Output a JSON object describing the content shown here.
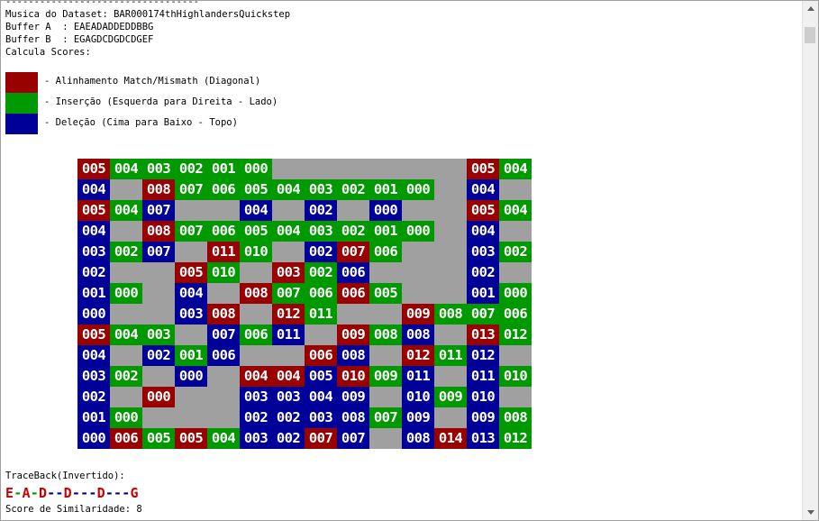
{
  "header_lines": [
    "----------------------------------",
    "Musica do Dataset: BAR000174thHighlandersQuickstep",
    "Buffer A  : EAEADADDEDDBBG",
    "Buffer B  : EGAGDCDGDCDGEF",
    "Calcula Scores:"
  ],
  "legend": [
    {
      "color": "#990000",
      "label": "- Alinhamento Match/Mismath (Diagonal)"
    },
    {
      "color": "#009900",
      "label": "- Inserção (Esquerda para Direita - Lado)"
    },
    {
      "color": "#000099",
      "label": "- Deleção (Cima para Baixo - Topo)"
    }
  ],
  "colors": {
    "R": "#990000",
    "G": "#009900",
    "B": "#000099",
    "empty": "#a0a0a0"
  },
  "matrix": [
    [
      [
        "R",
        "005"
      ],
      [
        "G",
        "004"
      ],
      [
        "G",
        "003"
      ],
      [
        "G",
        "002"
      ],
      [
        "G",
        "001"
      ],
      [
        "G",
        "000"
      ],
      null,
      null,
      null,
      null,
      null,
      null,
      [
        "R",
        "005"
      ],
      [
        "G",
        "004"
      ]
    ],
    [
      [
        "B",
        "004"
      ],
      null,
      [
        "R",
        "008"
      ],
      [
        "G",
        "007"
      ],
      [
        "G",
        "006"
      ],
      [
        "G",
        "005"
      ],
      [
        "G",
        "004"
      ],
      [
        "G",
        "003"
      ],
      [
        "G",
        "002"
      ],
      [
        "G",
        "001"
      ],
      [
        "G",
        "000"
      ],
      null,
      [
        "B",
        "004"
      ],
      null
    ],
    [
      [
        "R",
        "005"
      ],
      [
        "G",
        "004"
      ],
      [
        "B",
        "007"
      ],
      null,
      null,
      [
        "B",
        "004"
      ],
      null,
      [
        "B",
        "002"
      ],
      null,
      [
        "B",
        "000"
      ],
      null,
      null,
      [
        "R",
        "005"
      ],
      [
        "G",
        "004"
      ]
    ],
    [
      [
        "B",
        "004"
      ],
      null,
      [
        "R",
        "008"
      ],
      [
        "G",
        "007"
      ],
      [
        "G",
        "006"
      ],
      [
        "G",
        "005"
      ],
      [
        "G",
        "004"
      ],
      [
        "G",
        "003"
      ],
      [
        "G",
        "002"
      ],
      [
        "G",
        "001"
      ],
      [
        "G",
        "000"
      ],
      null,
      [
        "B",
        "004"
      ],
      null
    ],
    [
      [
        "B",
        "003"
      ],
      [
        "G",
        "002"
      ],
      [
        "B",
        "007"
      ],
      null,
      [
        "R",
        "011"
      ],
      [
        "G",
        "010"
      ],
      null,
      [
        "B",
        "002"
      ],
      [
        "R",
        "007"
      ],
      [
        "G",
        "006"
      ],
      null,
      null,
      [
        "B",
        "003"
      ],
      [
        "G",
        "002"
      ]
    ],
    [
      [
        "B",
        "002"
      ],
      null,
      null,
      [
        "R",
        "005"
      ],
      [
        "G",
        "010"
      ],
      null,
      [
        "R",
        "003"
      ],
      [
        "G",
        "002"
      ],
      [
        "B",
        "006"
      ],
      null,
      null,
      null,
      [
        "B",
        "002"
      ],
      null
    ],
    [
      [
        "B",
        "001"
      ],
      [
        "G",
        "000"
      ],
      null,
      [
        "B",
        "004"
      ],
      null,
      [
        "R",
        "008"
      ],
      [
        "G",
        "007"
      ],
      [
        "G",
        "006"
      ],
      [
        "R",
        "006"
      ],
      [
        "G",
        "005"
      ],
      null,
      null,
      [
        "B",
        "001"
      ],
      [
        "G",
        "000"
      ]
    ],
    [
      [
        "B",
        "000"
      ],
      null,
      null,
      [
        "B",
        "003"
      ],
      [
        "R",
        "008"
      ],
      null,
      [
        "R",
        "012"
      ],
      [
        "G",
        "011"
      ],
      null,
      null,
      [
        "R",
        "009"
      ],
      [
        "G",
        "008"
      ],
      [
        "G",
        "007"
      ],
      [
        "G",
        "006"
      ]
    ],
    [
      [
        "R",
        "005"
      ],
      [
        "G",
        "004"
      ],
      [
        "G",
        "003"
      ],
      null,
      [
        "B",
        "007"
      ],
      [
        "G",
        "006"
      ],
      [
        "B",
        "011"
      ],
      null,
      [
        "R",
        "009"
      ],
      [
        "G",
        "008"
      ],
      [
        "B",
        "008"
      ],
      null,
      [
        "R",
        "013"
      ],
      [
        "G",
        "012"
      ]
    ],
    [
      [
        "B",
        "004"
      ],
      null,
      [
        "B",
        "002"
      ],
      [
        "G",
        "001"
      ],
      [
        "B",
        "006"
      ],
      null,
      null,
      [
        "R",
        "006"
      ],
      [
        "B",
        "008"
      ],
      null,
      [
        "R",
        "012"
      ],
      [
        "G",
        "011"
      ],
      [
        "B",
        "012"
      ],
      null
    ],
    [
      [
        "B",
        "003"
      ],
      [
        "G",
        "002"
      ],
      null,
      [
        "B",
        "000"
      ],
      null,
      [
        "R",
        "004"
      ],
      [
        "R",
        "004"
      ],
      [
        "B",
        "005"
      ],
      [
        "R",
        "010"
      ],
      [
        "G",
        "009"
      ],
      [
        "B",
        "011"
      ],
      null,
      [
        "B",
        "011"
      ],
      [
        "G",
        "010"
      ]
    ],
    [
      [
        "B",
        "002"
      ],
      null,
      [
        "R",
        "000"
      ],
      null,
      null,
      [
        "B",
        "003"
      ],
      [
        "B",
        "003"
      ],
      [
        "B",
        "004"
      ],
      [
        "B",
        "009"
      ],
      null,
      [
        "B",
        "010"
      ],
      [
        "G",
        "009"
      ],
      [
        "B",
        "010"
      ],
      null
    ],
    [
      [
        "B",
        "001"
      ],
      [
        "G",
        "000"
      ],
      null,
      null,
      null,
      [
        "B",
        "002"
      ],
      [
        "B",
        "002"
      ],
      [
        "B",
        "003"
      ],
      [
        "B",
        "008"
      ],
      [
        "G",
        "007"
      ],
      [
        "B",
        "009"
      ],
      null,
      [
        "B",
        "009"
      ],
      [
        "G",
        "008"
      ]
    ],
    [
      [
        "B",
        "000"
      ],
      [
        "R",
        "006"
      ],
      [
        "G",
        "005"
      ],
      [
        "R",
        "005"
      ],
      [
        "G",
        "004"
      ],
      [
        "B",
        "003"
      ],
      [
        "B",
        "002"
      ],
      [
        "R",
        "007"
      ],
      [
        "B",
        "007"
      ],
      null,
      [
        "B",
        "008"
      ],
      [
        "R",
        "014"
      ],
      [
        "B",
        "013"
      ],
      [
        "G",
        "012"
      ]
    ]
  ],
  "traceback_label": "TraceBack(Invertido):",
  "traceback": [
    {
      "t": "E",
      "c": "#cc0000"
    },
    {
      "t": "-",
      "c": "#009900"
    },
    {
      "t": "A",
      "c": "#cc0000"
    },
    {
      "t": "-",
      "c": "#009900"
    },
    {
      "t": "D",
      "c": "#cc0000"
    },
    {
      "t": "--",
      "c": "#000099"
    },
    {
      "t": "D",
      "c": "#cc0000"
    },
    {
      "t": "---",
      "c": "#000099"
    },
    {
      "t": "D",
      "c": "#cc0000"
    },
    {
      "t": "---",
      "c": "#000099"
    },
    {
      "t": "G",
      "c": "#cc0000"
    }
  ],
  "score_label": "Score de Similaridade: 8"
}
